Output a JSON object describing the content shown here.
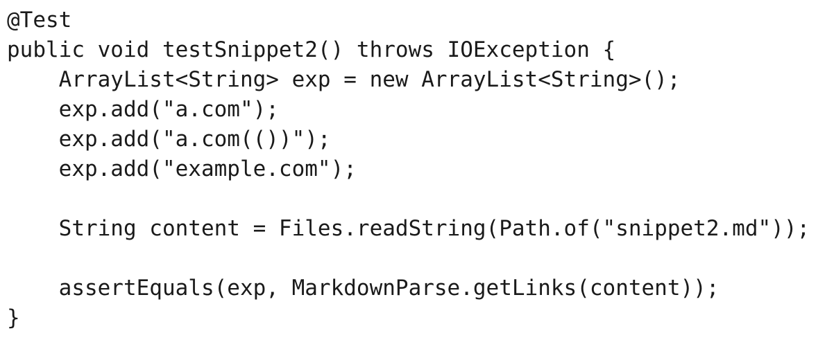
{
  "code": {
    "lines": [
      "@Test",
      "public void testSnippet2() throws IOException {",
      "    ArrayList<String> exp = new ArrayList<String>();",
      "    exp.add(\"a.com\");",
      "    exp.add(\"a.com(())\");",
      "    exp.add(\"example.com\");",
      "",
      "    String content = Files.readString(Path.of(\"snippet2.md\"));",
      "",
      "    assertEquals(exp, MarkdownParse.getLinks(content));",
      "}"
    ]
  }
}
